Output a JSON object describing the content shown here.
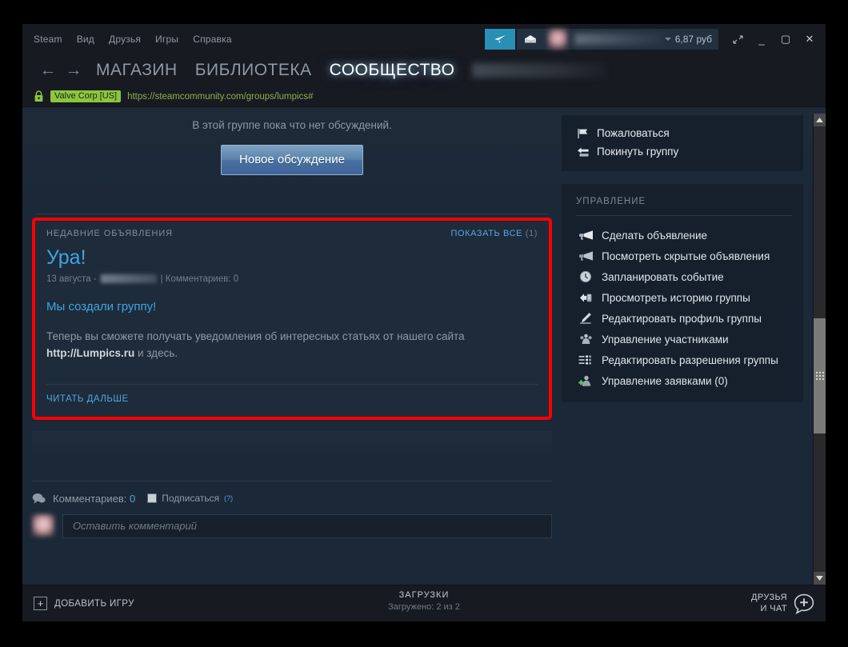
{
  "window": {
    "menu": [
      "Steam",
      "Вид",
      "Друзья",
      "Игры",
      "Справка"
    ],
    "wallet": "6,87 руб",
    "icons": {
      "broadcast": "broadcast-icon",
      "mail": "mail-icon",
      "resize": "restore-size-icon",
      "minimize": "_",
      "maximize": "▢",
      "close": "✕"
    }
  },
  "nav": {
    "back": "←",
    "forward": "→",
    "tabs": [
      {
        "label": "МАГАЗИН",
        "active": false
      },
      {
        "label": "БИБЛИОТЕКА",
        "active": false
      },
      {
        "label": "СООБЩЕСТВО",
        "active": true
      }
    ]
  },
  "url": {
    "cert": "Valve Corp [US]",
    "address": "https://steamcommunity.com/groups/lumpics#"
  },
  "main": {
    "no_discussions": "В этой группе пока что нет обсуждений.",
    "new_discussion_button": "Новое обсуждение",
    "announcements": {
      "section_title": "НЕДАВНИЕ ОБЪЯВЛЕНИЯ",
      "show_all_label": "ПОКАЗАТЬ ВСЕ",
      "show_all_count": "(1)",
      "title": "Ура!",
      "meta_date": "13 августа -",
      "meta_comments": "| Комментариев: 0",
      "subtitle": "Мы создали группу!",
      "body_line1": "Теперь вы сможете получать уведомления об интересных статьях от нашего сайта",
      "body_link": "http://Lumpics.ru",
      "body_line2": " и здесь.",
      "read_more": "ЧИТАТЬ ДАЛЬШЕ",
      "highlight_color": "#fd0000"
    },
    "comments": {
      "label": "Комментариев:",
      "count": "0",
      "subscribe_label": "Подписаться",
      "help": "(?)",
      "input_placeholder": "Оставить комментарий"
    }
  },
  "sidebar": {
    "actions": [
      {
        "label": "Пожаловаться",
        "icon": "flag-icon"
      },
      {
        "label": "Покинуть группу",
        "icon": "leave-group-icon"
      }
    ],
    "management_header": "УПРАВЛЕНИЕ",
    "management": [
      {
        "label": "Сделать объявление",
        "icon": "megaphone-icon"
      },
      {
        "label": "Посмотреть скрытые объявления",
        "icon": "megaphone-hidden-icon"
      },
      {
        "label": "Запланировать событие",
        "icon": "clock-icon"
      },
      {
        "label": "Просмотреть историю группы",
        "icon": "history-icon"
      },
      {
        "label": "Редактировать профиль группы",
        "icon": "pencil-icon"
      },
      {
        "label": "Управление участниками",
        "icon": "members-icon"
      },
      {
        "label": "Редактировать разрешения группы",
        "icon": "permissions-icon"
      },
      {
        "label": "Управление заявками (0)",
        "icon": "add-user-icon"
      }
    ]
  },
  "footer": {
    "add_game": "ДОБАВИТЬ ИГРУ",
    "downloads_title": "ЗАГРУЗКИ",
    "downloads_status": "Загружено: 2 из 2",
    "friends_line1": "ДРУЗЬЯ",
    "friends_line2": "И ЧАТ"
  }
}
